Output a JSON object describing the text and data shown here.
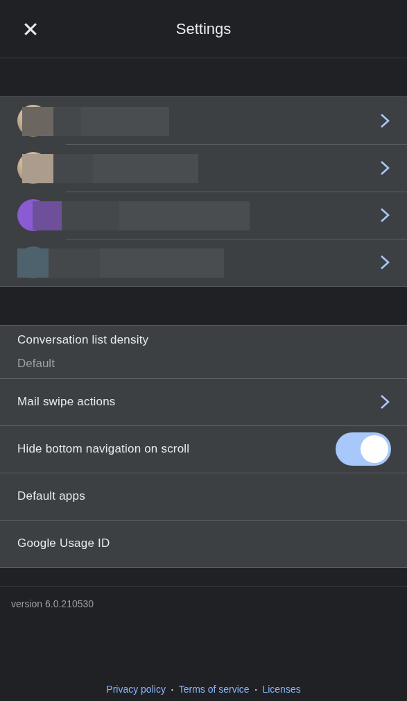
{
  "header": {
    "close": "✕",
    "title": "Settings"
  },
  "accounts": [
    {
      "kind": "photo"
    },
    {
      "kind": "photo"
    },
    {
      "kind": "letter",
      "color": "#8a5bd3"
    },
    {
      "kind": "plain",
      "color": "#4e626e"
    }
  ],
  "settings": [
    {
      "kind": "value",
      "label": "Conversation list density",
      "value": "Default"
    },
    {
      "kind": "link",
      "label": "Mail swipe actions"
    },
    {
      "kind": "toggle",
      "label": "Hide bottom navigation on scroll",
      "on": true
    },
    {
      "kind": "plain",
      "label": "Default apps"
    },
    {
      "kind": "plain",
      "label": "Google Usage ID"
    }
  ],
  "version": "version 6.0.210530",
  "footer": {
    "links": [
      "Privacy policy",
      "Terms of service",
      "Licenses"
    ],
    "separator": "•"
  }
}
